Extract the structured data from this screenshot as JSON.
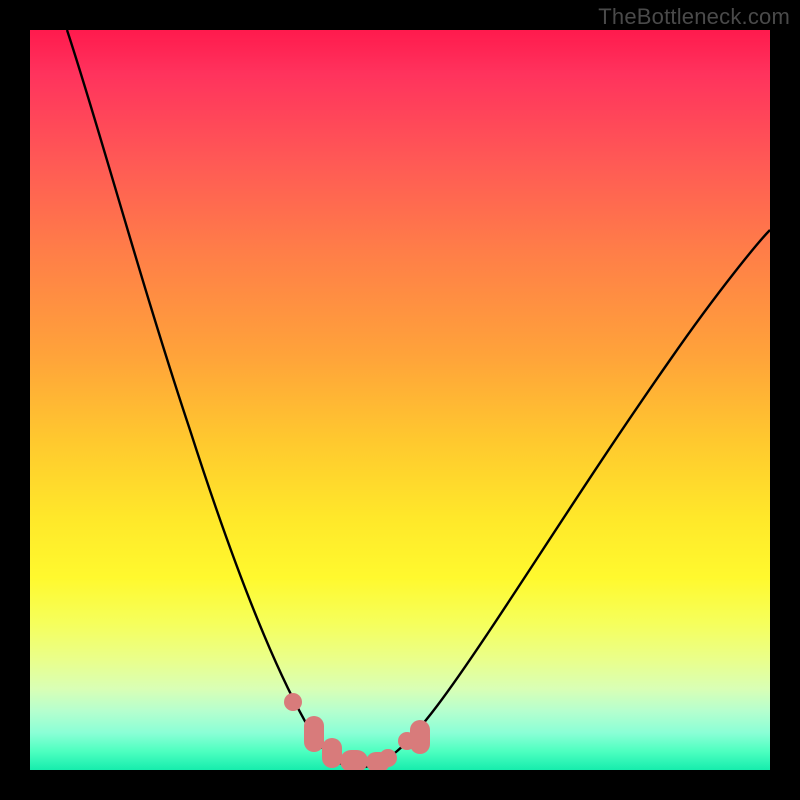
{
  "watermark": "TheBottleneck.com",
  "chart_data": {
    "type": "line",
    "title": "",
    "xlabel": "",
    "ylabel": "",
    "xlim": [
      0,
      100
    ],
    "ylim": [
      0,
      100
    ],
    "grid": false,
    "series": [
      {
        "name": "curve",
        "x": [
          5,
          8,
          12,
          16,
          20,
          24,
          28,
          31,
          33,
          35,
          37,
          38.5,
          40,
          42,
          44,
          46,
          48,
          50,
          52,
          55,
          59,
          64,
          70,
          77,
          85,
          93,
          100
        ],
        "y": [
          100,
          90,
          77,
          63,
          50,
          37,
          25,
          15,
          10,
          6,
          3,
          1.5,
          0.5,
          0.2,
          0.2,
          0.3,
          0.7,
          1.8,
          3.8,
          7.5,
          13,
          21,
          30,
          40,
          51,
          61,
          70
        ]
      }
    ],
    "annotations": {
      "optimal_region": {
        "x_start": 37,
        "x_end": 53,
        "color": "#d87b7b"
      }
    },
    "background_gradient": {
      "stops": [
        {
          "pos": 0,
          "color": "#ff1a4d"
        },
        {
          "pos": 50,
          "color": "#ffca2e"
        },
        {
          "pos": 80,
          "color": "#f6ff5a"
        },
        {
          "pos": 100,
          "color": "#16edad"
        }
      ]
    }
  }
}
